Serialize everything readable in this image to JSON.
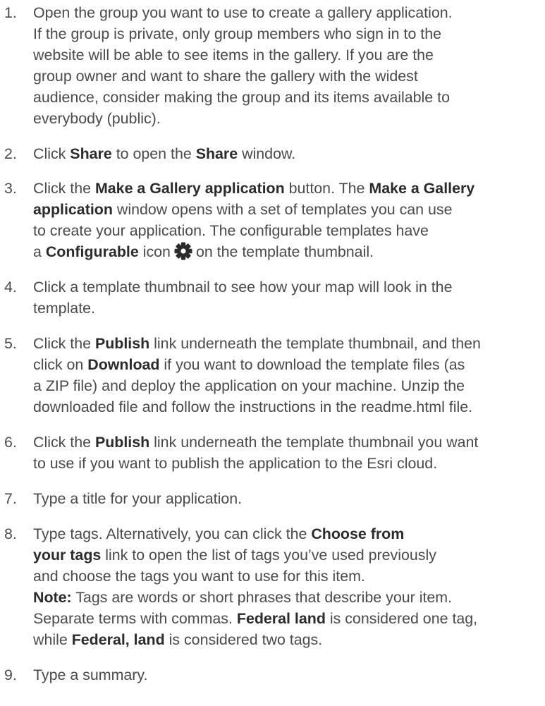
{
  "steps": [
    {
      "number": "1.",
      "lines": [
        "Open the group you want to use to create a gallery application.",
        "If the group is private, only group members who sign in to the",
        "website will be able to see items in the gallery. If you are the",
        "group owner and want to share the gallery with the widest",
        "audience, consider making the group and its items available to",
        "everybody (public)."
      ]
    },
    {
      "number": "2.",
      "l1_a": "Click ",
      "l1_b": "Share",
      "l1_c": " to open the ",
      "l1_d": "Share",
      "l1_e": " window."
    },
    {
      "number": "3.",
      "l1_a": "Click the ",
      "l1_b": "Make a Gallery application",
      "l1_c": " button. The ",
      "l1_d": "Make a Gallery",
      "l2_a": "application",
      "l2_b": " window opens with a set of templates you can use",
      "l3": "to create your application. The configurable templates have",
      "l4_a": "a ",
      "l4_b": "Configurable",
      "l4_c": " icon",
      "l4_d": "on the template thumbnail.",
      "icon": "gear-icon"
    },
    {
      "number": "4.",
      "lines": [
        "Click a template thumbnail to see how your map will look in the",
        "template."
      ]
    },
    {
      "number": "5.",
      "l1_a": "Click the ",
      "l1_b": "Publish",
      "l1_c": " link underneath the template thumbnail, and then",
      "l2_a": "click on ",
      "l2_b": "Download",
      "l2_c": " if you want to download the template files (as",
      "l3": "a ZIP file) and deploy the application on your machine. Unzip the",
      "l4": "downloaded file and follow the instructions in the readme.html file."
    },
    {
      "number": "6.",
      "l1_a": "Click the ",
      "l1_b": "Publish",
      "l1_c": " link underneath the template thumbnail you want",
      "l2": "to use if you want to publish the application to the Esri cloud."
    },
    {
      "number": "7.",
      "lines": [
        "Type a title for your application."
      ]
    },
    {
      "number": "8.",
      "l1_a": "Type tags. Alternatively, you can click the ",
      "l1_b": "Choose from",
      "l2_a": "your tags",
      "l2_b": " link to open the list of tags you’ve used previously",
      "l3": "and choose the tags you want to use for this item.",
      "l4_a": "Note:",
      "l4_b": " Tags are words or short phrases that describe your item.",
      "l5_a": "Separate terms with commas. ",
      "l5_b": "Federal land",
      "l5_c": " is considered one tag,",
      "l6_a": "while ",
      "l6_b": "Federal, land",
      "l6_c": " is considered two tags."
    },
    {
      "number": "9.",
      "lines": [
        "Type a summary."
      ]
    }
  ]
}
